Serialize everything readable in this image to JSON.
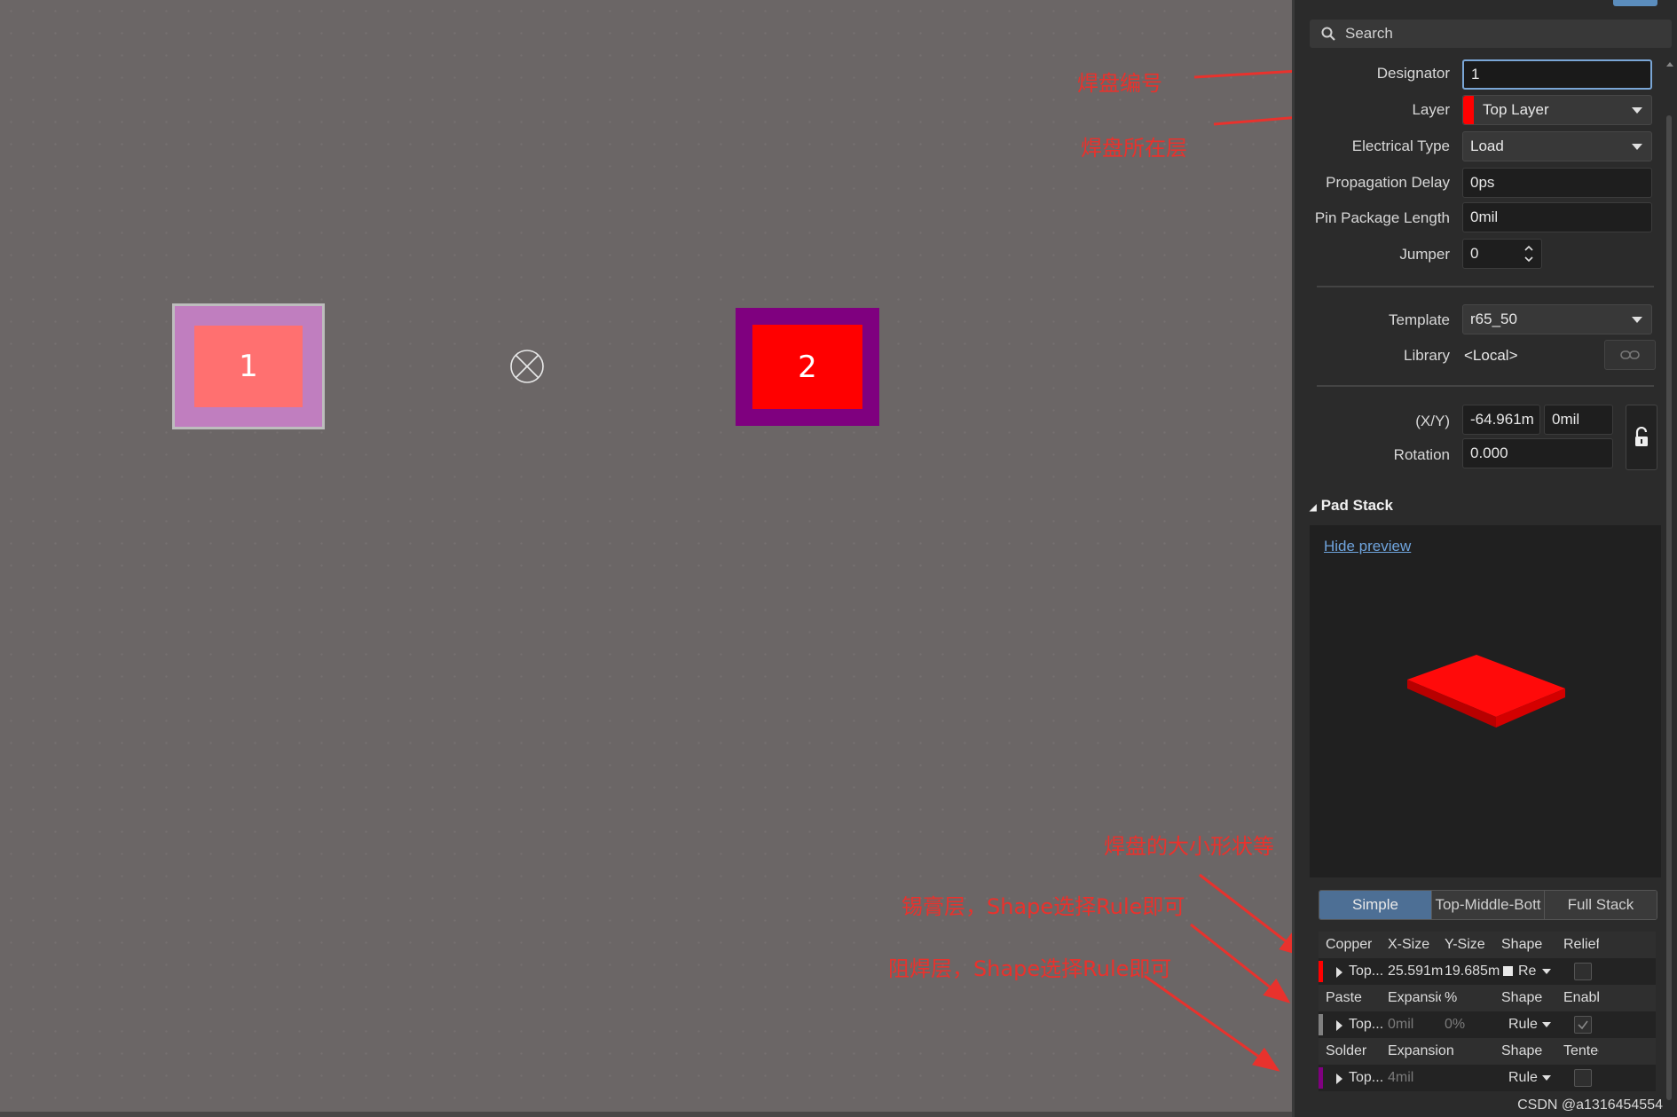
{
  "canvas": {
    "pad1_label": "1",
    "pad2_label": "2",
    "annotations": {
      "designator_note": "焊盘编号",
      "layer_note": "焊盘所在层",
      "size_note": "焊盘的大小形状等",
      "paste_note": "锡膏层，Shape选择Rule即可",
      "solder_note": "阻焊层，Shape选择Rule即可"
    },
    "annotation_color": "#e8322d",
    "watermark": "CSDN @a1316454554"
  },
  "panel": {
    "search_placeholder": "Search",
    "designator": {
      "label": "Designator",
      "value": "1"
    },
    "layer": {
      "label": "Layer",
      "value": "Top Layer",
      "color": "#ff0000"
    },
    "electrical_type": {
      "label": "Electrical Type",
      "value": "Load"
    },
    "propagation_delay": {
      "label": "Propagation Delay",
      "value": "0ps"
    },
    "pin_package_length": {
      "label": "Pin Package Length",
      "value": "0mil"
    },
    "jumper": {
      "label": "Jumper",
      "value": "0"
    },
    "template": {
      "label": "Template",
      "value": "r65_50"
    },
    "library": {
      "label": "Library",
      "value": "<Local>"
    },
    "xy": {
      "label": "(X/Y)",
      "x": "-64.961m",
      "y": "0mil"
    },
    "rotation": {
      "label": "Rotation",
      "value": "0.000"
    },
    "pad_stack": {
      "title": "Pad Stack",
      "hide_preview": "Hide preview",
      "tabs": [
        "Simple",
        "Top-Middle-Bott",
        "Full Stack"
      ],
      "active_tab": "Simple",
      "copper": {
        "headers": [
          "Copper",
          "X-Size",
          "Y-Size",
          "Shape",
          "Relief"
        ],
        "row": {
          "layer": "Top...",
          "x_size": "25.591m",
          "y_size": "19.685m",
          "shape": "Re",
          "color": "#ff0000"
        }
      },
      "paste": {
        "headers": [
          "Paste",
          "Expansion",
          "%",
          "Shape",
          "Enable"
        ],
        "row": {
          "layer": "Top...",
          "expansion": "0mil",
          "percent": "0%",
          "shape": "Rule",
          "color": "#808080"
        }
      },
      "solder": {
        "headers": [
          "Solder",
          "Expansion",
          "Shape",
          "Tented"
        ],
        "row": {
          "layer": "Top...",
          "expansion": "4mil",
          "shape": "Rule",
          "color": "#800080"
        }
      }
    }
  }
}
